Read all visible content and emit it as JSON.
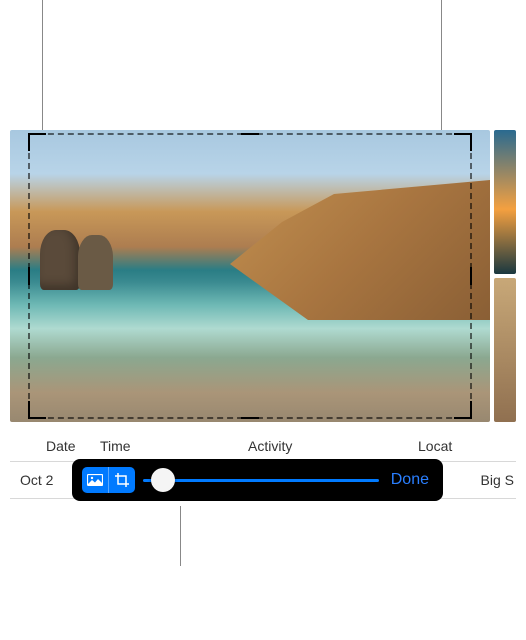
{
  "table": {
    "columns": {
      "date": "Date",
      "time": "Time",
      "activity": "Activity",
      "location": "Locat"
    },
    "row": {
      "date": "Oct 2",
      "location": "Big S"
    }
  },
  "toolbar": {
    "done_label": "Done",
    "slider_value": 10
  },
  "icons": {
    "photo_mode": "photo-icon",
    "crop_mode": "crop-icon"
  }
}
